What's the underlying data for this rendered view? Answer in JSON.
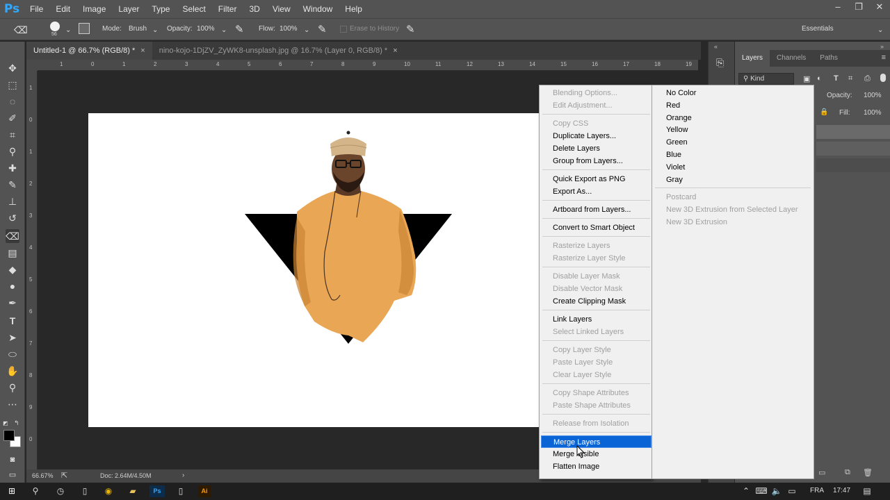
{
  "app": {
    "logo": "Ps",
    "menus": [
      "File",
      "Edit",
      "Image",
      "Layer",
      "Type",
      "Select",
      "Filter",
      "3D",
      "View",
      "Window",
      "Help"
    ]
  },
  "options_bar": {
    "brush_size": "56",
    "mode_label": "Mode:",
    "mode_value": "Brush",
    "opacity_label": "Opacity:",
    "opacity_value": "100%",
    "flow_label": "Flow:",
    "flow_value": "100%",
    "erase_history_label": "Erase to History",
    "workspace": "Essentials"
  },
  "tabs": [
    {
      "label": "Untitled-1 @ 66.7% (RGB/8) *",
      "close": "×"
    },
    {
      "label": "nino-kojo-1DjZV_ZyWK8-unsplash.jpg @ 16.7% (Layer 0, RGB/8) *",
      "close": "×"
    }
  ],
  "ruler": {
    "h_ticks": [
      "1",
      "0",
      "1",
      "2",
      "3",
      "4",
      "5",
      "6",
      "7",
      "8",
      "9",
      "10",
      "11",
      "12",
      "13",
      "14",
      "15",
      "16",
      "17",
      "18",
      "19"
    ],
    "v_ticks": [
      "1",
      "0",
      "1",
      "2",
      "3",
      "4",
      "5",
      "6",
      "7",
      "8",
      "9",
      "0"
    ]
  },
  "status": {
    "zoom": "66.67%",
    "doc": "Doc: 2.64M/4.50M"
  },
  "layers_panel": {
    "tabs": [
      "Layers",
      "Channels",
      "Paths"
    ],
    "kind": "Kind",
    "opacity_label": "Opacity:",
    "opacity_value": "100%",
    "fill_label": "Fill:",
    "fill_value": "100%"
  },
  "context_menu": {
    "groups": [
      [
        {
          "label": "Blending Options...",
          "enabled": false
        },
        {
          "label": "Edit Adjustment...",
          "enabled": false
        }
      ],
      [
        {
          "label": "Copy CSS",
          "enabled": false
        },
        {
          "label": "Duplicate Layers...",
          "enabled": true
        },
        {
          "label": "Delete Layers",
          "enabled": true
        },
        {
          "label": "Group from Layers...",
          "enabled": true
        }
      ],
      [
        {
          "label": "Quick Export as PNG",
          "enabled": true
        },
        {
          "label": "Export As...",
          "enabled": true
        }
      ],
      [
        {
          "label": "Artboard from Layers...",
          "enabled": true
        }
      ],
      [
        {
          "label": "Convert to Smart Object",
          "enabled": true
        }
      ],
      [
        {
          "label": "Rasterize Layers",
          "enabled": false
        },
        {
          "label": "Rasterize Layer Style",
          "enabled": false
        }
      ],
      [
        {
          "label": "Disable Layer Mask",
          "enabled": false
        },
        {
          "label": "Disable Vector Mask",
          "enabled": false
        },
        {
          "label": "Create Clipping Mask",
          "enabled": true
        }
      ],
      [
        {
          "label": "Link Layers",
          "enabled": true
        },
        {
          "label": "Select Linked Layers",
          "enabled": false
        }
      ],
      [
        {
          "label": "Copy Layer Style",
          "enabled": false
        },
        {
          "label": "Paste Layer Style",
          "enabled": false
        },
        {
          "label": "Clear Layer Style",
          "enabled": false
        }
      ],
      [
        {
          "label": "Copy Shape Attributes",
          "enabled": false
        },
        {
          "label": "Paste Shape Attributes",
          "enabled": false
        }
      ],
      [
        {
          "label": "Release from Isolation",
          "enabled": false
        }
      ],
      [
        {
          "label": "Merge Layers",
          "enabled": true,
          "highlighted": true
        },
        {
          "label": "Merge Visible",
          "enabled": true
        },
        {
          "label": "Flatten Image",
          "enabled": true
        }
      ]
    ]
  },
  "submenu": {
    "groups": [
      [
        {
          "label": "No Color",
          "enabled": true
        },
        {
          "label": "Red",
          "enabled": true
        },
        {
          "label": "Orange",
          "enabled": true
        },
        {
          "label": "Yellow",
          "enabled": true
        },
        {
          "label": "Green",
          "enabled": true
        },
        {
          "label": "Blue",
          "enabled": true
        },
        {
          "label": "Violet",
          "enabled": true
        },
        {
          "label": "Gray",
          "enabled": true
        }
      ],
      [
        {
          "label": "Postcard",
          "enabled": false
        },
        {
          "label": "New 3D Extrusion from Selected Layer",
          "enabled": false
        },
        {
          "label": "New 3D Extrusion",
          "enabled": false
        }
      ]
    ]
  },
  "taskbar": {
    "lang": "FRA",
    "time": "17:47"
  },
  "colors": {
    "highlight": "#0a64d6",
    "ps_blue": "#31a8ff",
    "shirt": "#e9a654"
  }
}
